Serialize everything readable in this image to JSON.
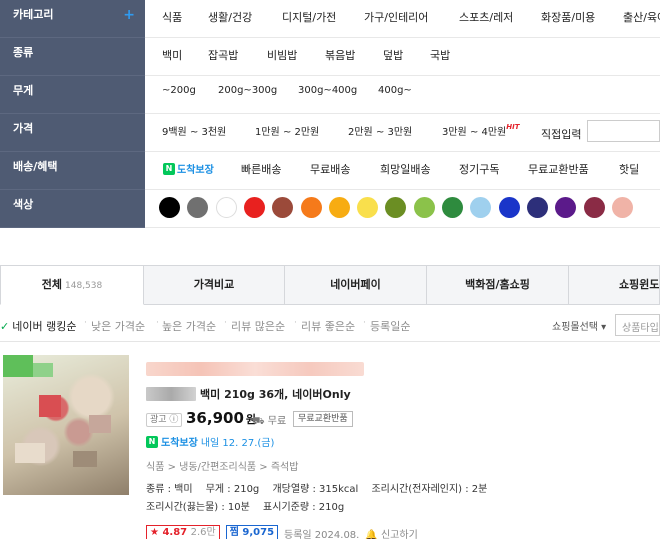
{
  "filters": {
    "category": {
      "label": "카테고리",
      "plus": "+",
      "options": [
        "식품",
        "생활/건강",
        "디지털/가전",
        "가구/인테리어",
        "스포츠/레저",
        "화장품/미용",
        "출산/육아"
      ]
    },
    "type": {
      "label": "종류",
      "options": [
        "백미",
        "잡곡밥",
        "비빔밥",
        "볶음밥",
        "덮밥",
        "국밥"
      ]
    },
    "weight": {
      "label": "무게",
      "options": [
        "~200g",
        "200g~300g",
        "300g~400g",
        "400g~"
      ]
    },
    "price": {
      "label": "가격",
      "options": [
        "9백원 ~ 3천원",
        "1만원 ~ 2만원",
        "2만원 ~ 3만원",
        "3만원 ~ 4만원"
      ],
      "hit": "HIT",
      "direct_input": "직접입력"
    },
    "delivery": {
      "label": "배송/혜택",
      "badge_n": "N",
      "badge": "도착보장",
      "options": [
        "빠른배송",
        "무료배송",
        "희망일배송",
        "정기구독",
        "무료교환반품",
        "핫딜"
      ]
    },
    "color": {
      "label": "색상",
      "swatches": [
        "#000000",
        "#707070",
        "#ffffff",
        "#e8211f",
        "#9b4a3a",
        "#f57a1a",
        "#f7ac12",
        "#f9df4c",
        "#6b8e23",
        "#8bc24a",
        "#2e8b3e",
        "#9fd0ee",
        "#1a35c9",
        "#2d2f7a",
        "#5b1a8a",
        "#8a2b45",
        "#f0b3a7"
      ]
    }
  },
  "tabs": [
    {
      "label": "전체",
      "count": "148,538"
    },
    {
      "label": "가격비교"
    },
    {
      "label": "네이버페이"
    },
    {
      "label": "백화점/홈쇼핑"
    },
    {
      "label": "쇼핑윈도"
    }
  ],
  "sort": {
    "options": [
      "네이버 랭킹순",
      "낮은 가격순",
      "높은 가격순",
      "리뷰 많은순",
      "리뷰 좋은순",
      "등록일순"
    ],
    "mall_select": "쇼핑몰선택 ▾",
    "mall_input_placeholder": "상품타입"
  },
  "product": {
    "title": "백미 210g 36개, 네이버Only",
    "ad_label": "광고 ⓘ",
    "price": "36,900",
    "price_unit": "원",
    "shipping": "무료",
    "free_return": "무료교환반품",
    "dochak_n": "N",
    "dochak": "도착보장",
    "dochak_date": "내일 12. 27.(금)",
    "breadcrumb": "식품 > 냉동/간편조리식품 > 즉석밥",
    "specs": [
      "종류 : 백미",
      "무게 : 210g",
      "개당열량 : 315kcal",
      "조리시간(전자레인지) : 2분",
      "조리시간(끓는물) : 10분",
      "표시기준량 : 210g"
    ],
    "rating": "★ 4.87",
    "review_count": "2.6만",
    "jjim": "찜 9,075",
    "registered": "등록일 2024.08.",
    "report": "🔔 신고하기"
  }
}
